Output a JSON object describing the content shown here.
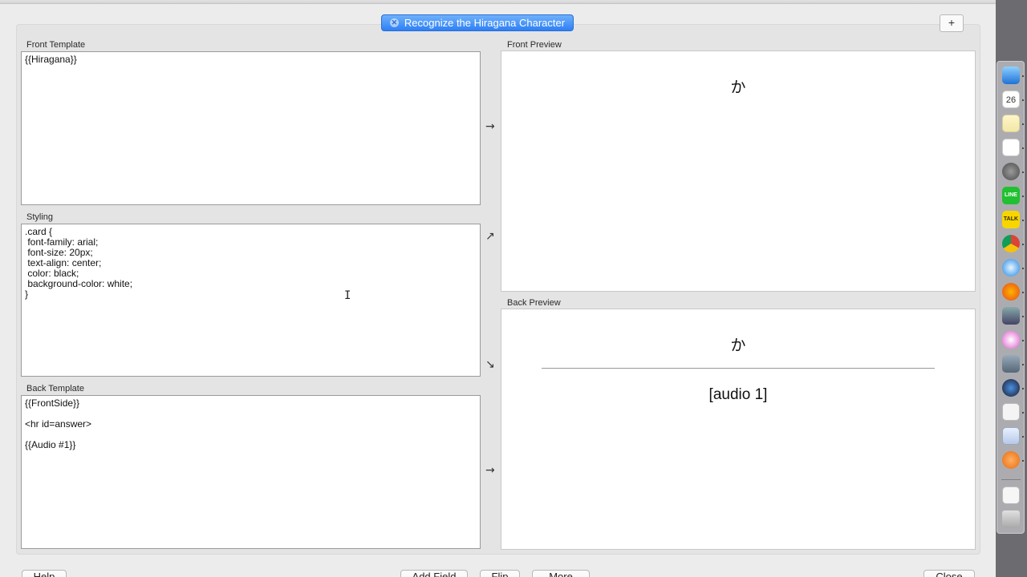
{
  "card_tab": {
    "label": "Recognize the Hiragana Character",
    "add_label": "+"
  },
  "front_template": {
    "label": "Front Template",
    "content": "{{Hiragana}}"
  },
  "styling": {
    "label": "Styling",
    "content": ".card {\n font-family: arial;\n font-size: 20px;\n text-align: center;\n color: black;\n background-color: white;\n}"
  },
  "back_template": {
    "label": "Back Template",
    "content": "{{FrontSide}}\n\n<hr id=answer>\n\n{{Audio #1}}"
  },
  "front_preview": {
    "label": "Front Preview",
    "character": "か"
  },
  "back_preview": {
    "label": "Back Preview",
    "character": "か",
    "audio": "[audio 1]"
  },
  "arrows": {
    "front": "→",
    "styling_up": "↗",
    "styling_down": "↘",
    "back": "→"
  },
  "buttons": {
    "help": "Help",
    "add_field": "Add Field",
    "flip": "Flip",
    "more": "More",
    "close": "Close"
  },
  "text_cursor": "I",
  "dock": {
    "calendar_day": "26",
    "line_label": "LINE",
    "talk_label": "TALK"
  }
}
